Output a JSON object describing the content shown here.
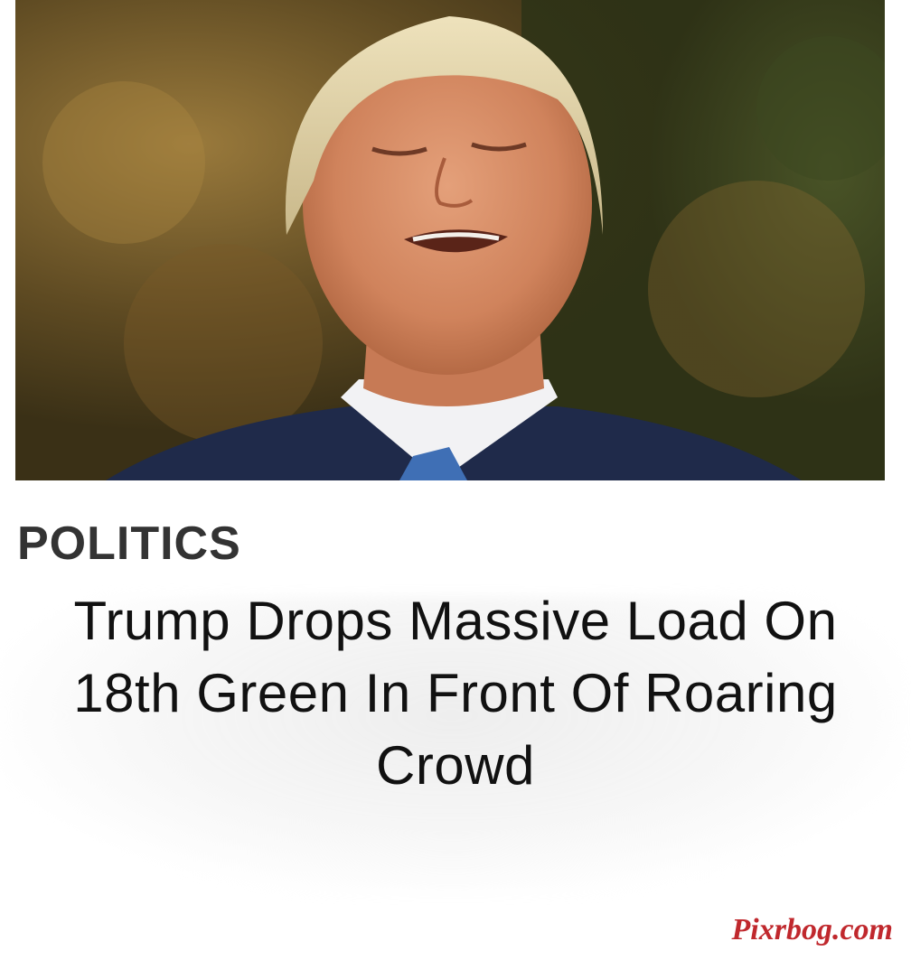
{
  "article": {
    "image_alt": "photo",
    "category": "POLITICS",
    "headline": "Trump Drops Massive Load On 18th Green In Front Of Roaring Crowd"
  },
  "watermark": {
    "text": "Pixrbog.com",
    "color": "#c0282d"
  }
}
